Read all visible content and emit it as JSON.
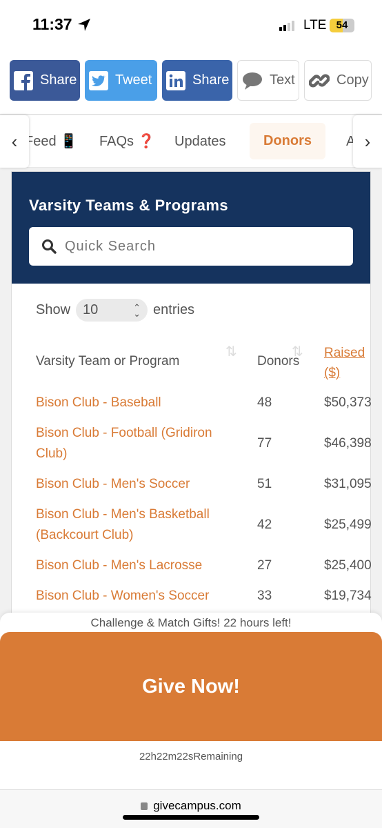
{
  "status_bar": {
    "time": "11:37",
    "network": "LTE",
    "battery": "54",
    "battery_level": 54,
    "signal_bars": 2
  },
  "share_buttons": [
    {
      "label": "Share",
      "icon": "facebook-icon",
      "color": "#3b5998"
    },
    {
      "label": "Tweet",
      "icon": "twitter-icon",
      "color": "#4a9fe8"
    },
    {
      "label": "Share",
      "icon": "linkedin-icon",
      "color": "#3a64aa"
    },
    {
      "label": "Text",
      "icon": "speech-bubble-icon"
    },
    {
      "label": "Copy",
      "icon": "link-icon"
    }
  ],
  "tabs": [
    {
      "label": "Feed 📱"
    },
    {
      "label": "FAQs ❓"
    },
    {
      "label": "Updates"
    },
    {
      "label": "Donors",
      "active": true
    },
    {
      "label": "A"
    }
  ],
  "card": {
    "title": "Varsity Teams & Programs",
    "search_placeholder": "Quick Search",
    "show_label": "Show",
    "entries_value": "10",
    "entries_label": "entries",
    "columns": [
      "Varsity Team or Program",
      "Donors",
      "Raised ($)"
    ],
    "rows": [
      {
        "name": "Bison Club - Baseball",
        "donors": "48",
        "raised": "$50,373"
      },
      {
        "name": "Bison Club - Football (Gridiron Club)",
        "donors": "77",
        "raised": "$46,398"
      },
      {
        "name": "Bison Club - Men's Soccer",
        "donors": "51",
        "raised": "$31,095"
      },
      {
        "name": "Bison Club - Men's Basketball (Backcourt Club)",
        "donors": "42",
        "raised": "$25,499"
      },
      {
        "name": "Bison Club - Men's Lacrosse",
        "donors": "27",
        "raised": "$25,400"
      },
      {
        "name": "Bison Club - Women's Soccer",
        "donors": "33",
        "raised": "$19,734"
      }
    ]
  },
  "footer": {
    "challenge": "Challenge & Match Gifts! 22 hours left!",
    "give_button": "Give Now!",
    "remaining": "22h22m22sRemaining",
    "url": "givecampus.com"
  },
  "colors": {
    "accent": "#d97b36",
    "navy": "#15335e"
  }
}
